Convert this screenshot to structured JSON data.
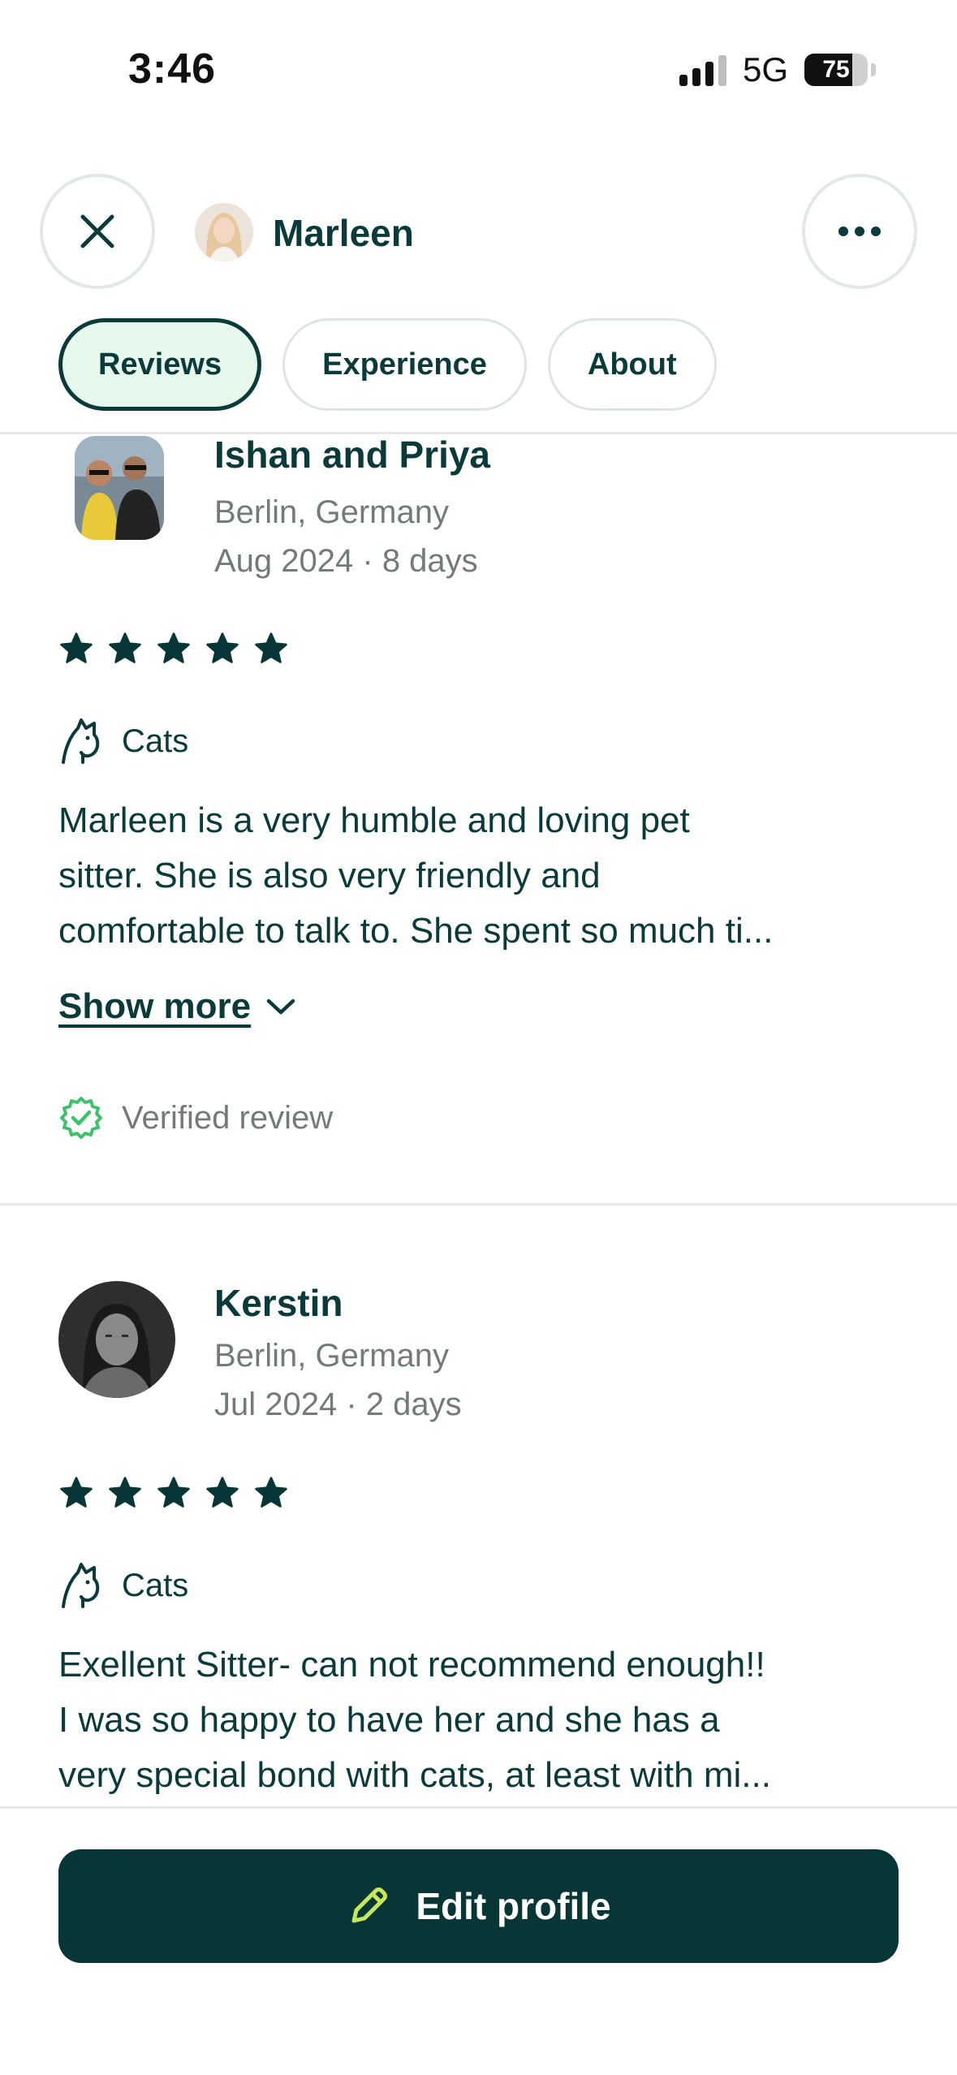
{
  "status_bar": {
    "time": "3:46",
    "network": "5G",
    "battery": "75",
    "battery_level": 0.75
  },
  "header": {
    "close_icon": "close-icon",
    "name": "Marleen",
    "more_icon": "more-horizontal-icon"
  },
  "tabs": [
    {
      "label": "Reviews",
      "active": true
    },
    {
      "label": "Experience",
      "active": false
    },
    {
      "label": "About",
      "active": false
    }
  ],
  "reviews": [
    {
      "name": "Ishan and Priya",
      "location": "Berlin, Germany",
      "date": "Aug 2024 · 8 days",
      "rating": 5,
      "pet_type": "Cats",
      "text_lines": [
        "Marleen is a very humble and loving pet",
        "sitter. She is also very friendly and",
        "comfortable to talk to. She spent so much ti..."
      ],
      "show_more": "Show more",
      "verified": "Verified review"
    },
    {
      "name": "Kerstin",
      "location": "Berlin, Germany",
      "date": "Jul 2024 · 2 days",
      "rating": 5,
      "pet_type": "Cats",
      "text_lines": [
        "Exellent Sitter- can not recommend enough!!",
        "I was so happy to have her and she has a",
        "very special bond with cats, at least with mi..."
      ]
    }
  ],
  "actions": {
    "edit_profile": "Edit profile"
  },
  "colors": {
    "brand": "#083536",
    "accent_green": "#3cc26a",
    "tab_active_bg": "#e6f7ec",
    "pencil": "#c7e85a"
  }
}
